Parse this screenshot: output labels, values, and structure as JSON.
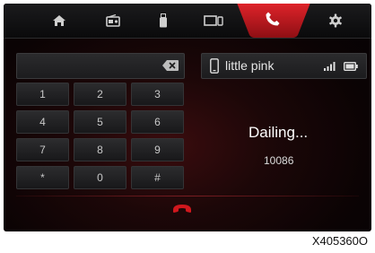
{
  "topbar": {
    "tabs": [
      {
        "name": "home",
        "icon": "home-icon"
      },
      {
        "name": "radio",
        "icon": "radio-icon"
      },
      {
        "name": "usb",
        "icon": "usb-icon"
      },
      {
        "name": "screen-mirroring",
        "icon": "screen-mirror-icon"
      },
      {
        "name": "phone",
        "icon": "phone-icon",
        "active": true
      },
      {
        "name": "settings",
        "icon": "gear-icon"
      }
    ],
    "active_color": "#c8171d"
  },
  "dialer": {
    "input_value": "",
    "keys": [
      "1",
      "2",
      "3",
      "4",
      "5",
      "6",
      "7",
      "8",
      "9",
      "*",
      "0",
      "#"
    ]
  },
  "device": {
    "name": "little pink",
    "icons": [
      "smartphone-icon",
      "signal-icon",
      "battery-icon"
    ]
  },
  "call": {
    "status": "Dailing...",
    "number": "10086"
  },
  "hangup": {
    "icon": "hang-up-icon",
    "color": "#d0171d"
  },
  "figure_code": "X405360O"
}
